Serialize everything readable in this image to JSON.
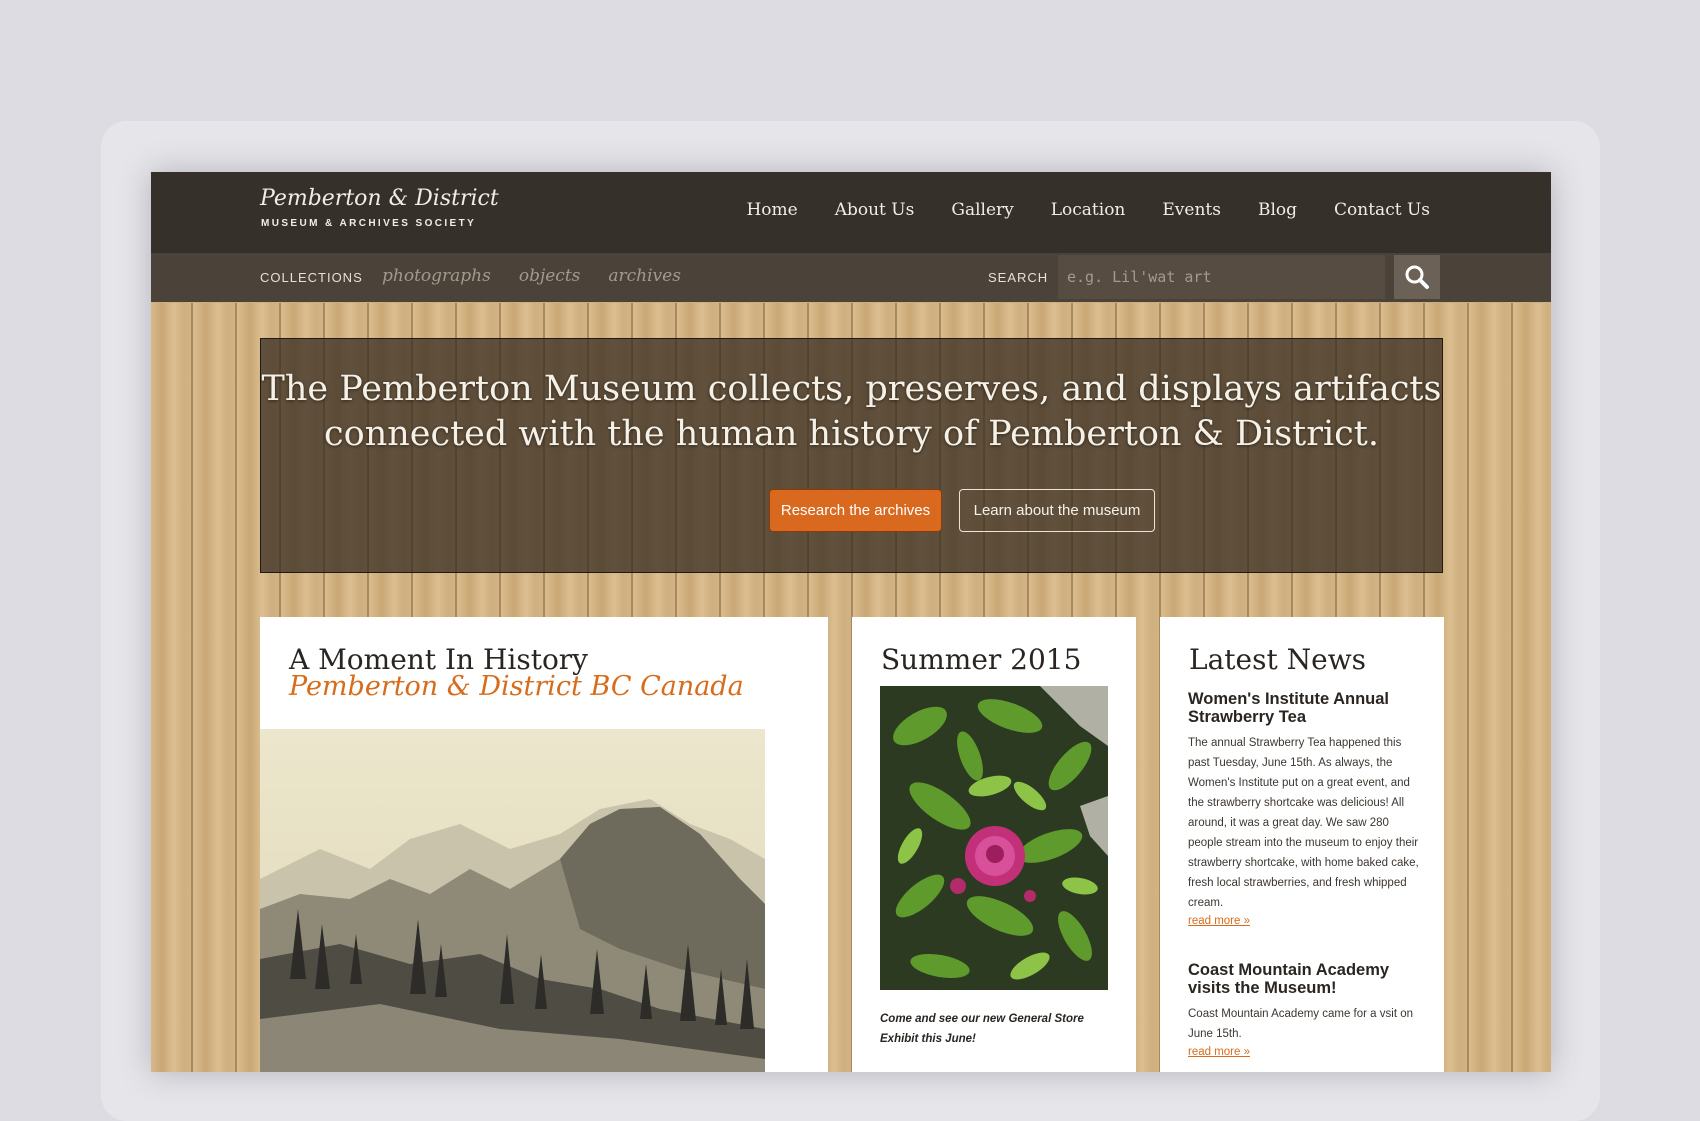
{
  "site": {
    "logo_title": "Pemberton & District",
    "logo_subtitle": "MUSEUM & ARCHIVES SOCIETY"
  },
  "nav": {
    "items": [
      "Home",
      "About Us",
      "Gallery",
      "Location",
      "Events",
      "Blog",
      "Contact Us"
    ]
  },
  "collections": {
    "label": "COLLECTIONS",
    "links": [
      "photographs",
      "objects",
      "archives"
    ]
  },
  "search": {
    "label": "SEARCH",
    "placeholder": "e.g. Lil'wat art",
    "icon": "search-icon"
  },
  "hero": {
    "line1": "The Pemberton Museum collects, preserves, and displays artifacts",
    "line2": "connected with the human history of Pemberton & District.",
    "primary_button": "Research the archives",
    "secondary_button": "Learn about the museum"
  },
  "moment": {
    "title": "A Moment In History",
    "subtitle": "Pemberton & District BC Canada"
  },
  "summer": {
    "title": "Summer 2015",
    "caption": "Come and see our new General Store Exhibit this June!"
  },
  "news": {
    "title": "Latest News",
    "items": [
      {
        "title": "Women's Institute Annual Strawberry Tea",
        "body": "The annual Strawberry Tea happened this past Tuesday, June 15th. As always, the Women's Institute put on a great event, and the strawberry shortcake was delicious! All around, it was a great day. We saw 280 people stream into the museum to enjoy their strawberry shortcake, with home baked cake, fresh local strawberries, and fresh whipped cream.",
        "link": "read more »"
      },
      {
        "title": "Coast Mountain Academy visits the Museum!",
        "body": "Coast Mountain Academy came for a vsit on June 15th.",
        "link": "read more »"
      }
    ]
  },
  "colors": {
    "header_bg": "#36302b",
    "accent_orange": "#d8691f",
    "wood": "#cfae7e"
  }
}
